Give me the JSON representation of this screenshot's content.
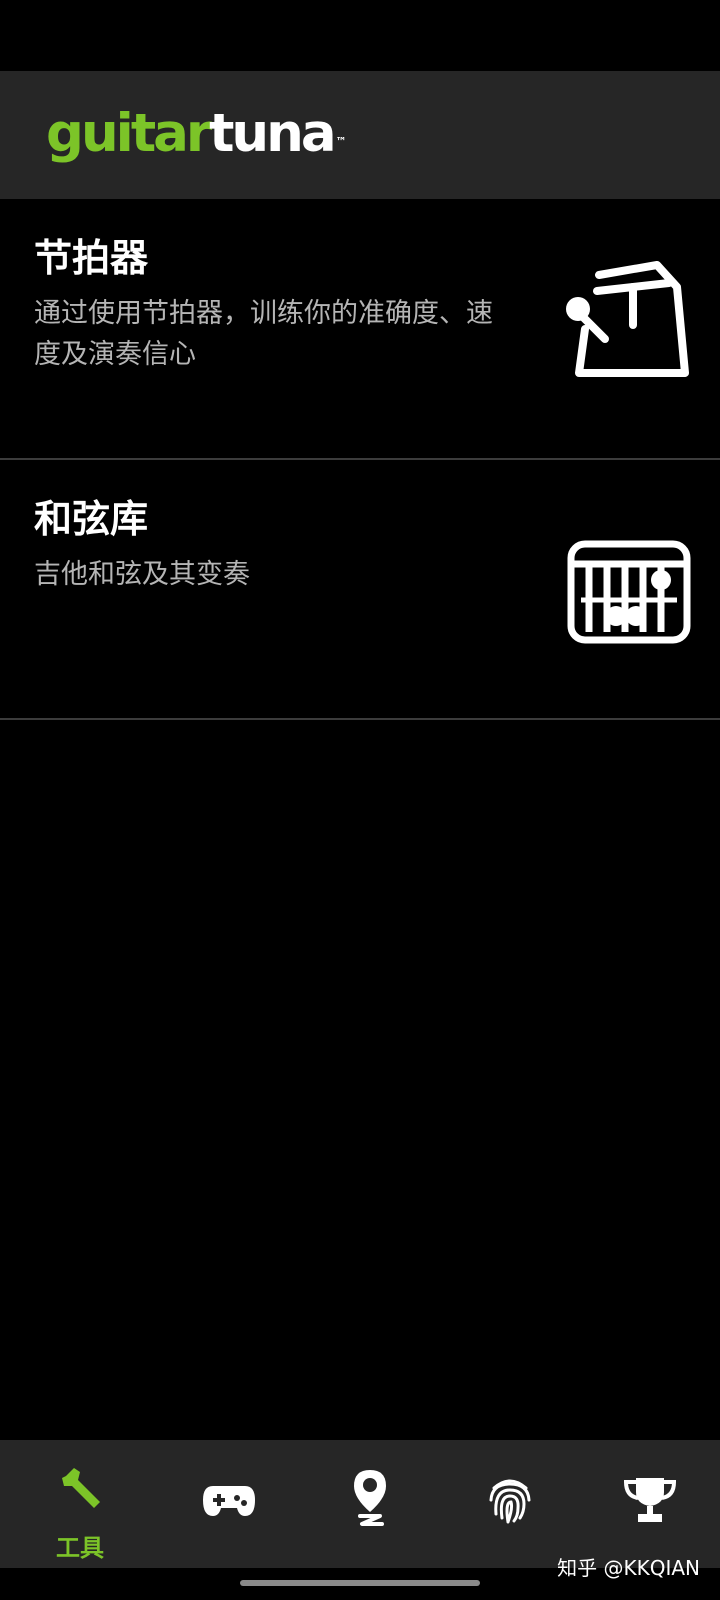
{
  "app": {
    "logo_part1": "guitar",
    "logo_part2": "tuna",
    "logo_tm": "™"
  },
  "tools": [
    {
      "title": "节拍器",
      "description": "通过使用节拍器，训练你的准确度、速度及演奏信心",
      "icon": "metronome-icon"
    },
    {
      "title": "和弦库",
      "description": "吉他和弦及其变奏",
      "icon": "chord-library-icon"
    }
  ],
  "bottom_nav": {
    "items": [
      {
        "icon": "wrench-icon",
        "label": "工具",
        "active": true
      },
      {
        "icon": "gamepad-icon",
        "label": ""
      },
      {
        "icon": "location-pin-icon",
        "label": ""
      },
      {
        "icon": "fingerprint-icon",
        "label": ""
      },
      {
        "icon": "trophy-icon",
        "label": ""
      }
    ]
  },
  "colors": {
    "brand_green": "#7cc428",
    "header_bg": "#262626",
    "background": "#000000",
    "desc_text": "#b5b5b5"
  },
  "watermark": "知乎 @KKQIAN"
}
